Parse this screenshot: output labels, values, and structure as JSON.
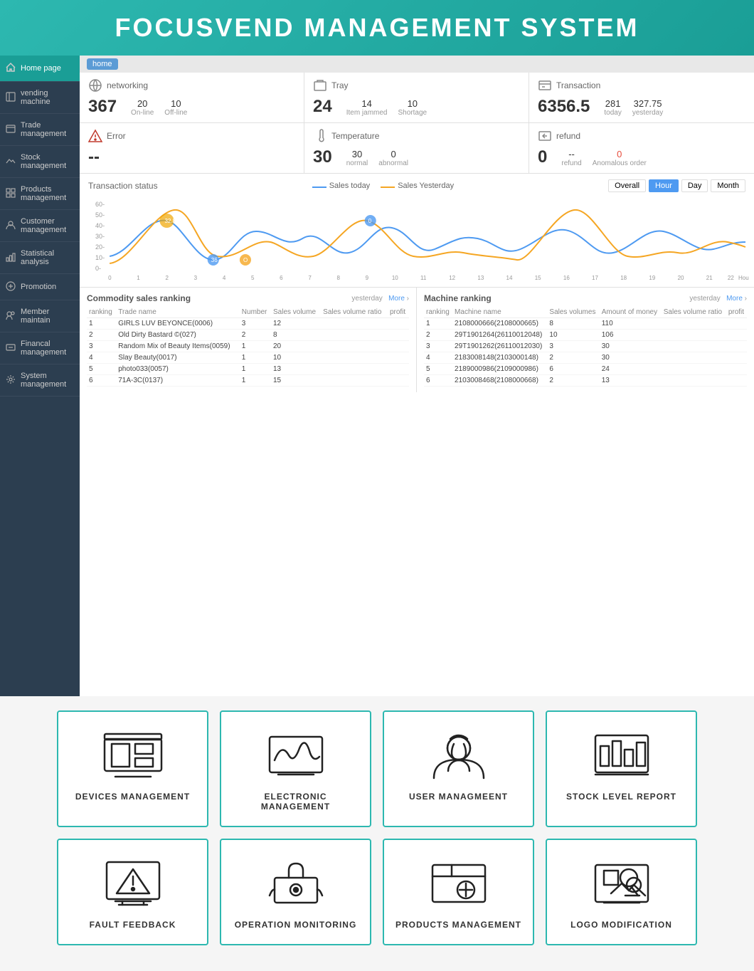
{
  "header": {
    "title": "FOCUSVEND MANAGEMENT SYSTEM"
  },
  "breadcrumb": {
    "home_label": "home"
  },
  "sidebar": {
    "items": [
      {
        "label": "Home page",
        "active": true
      },
      {
        "label": "vending machine",
        "active": false
      },
      {
        "label": "Trade management",
        "active": false
      },
      {
        "label": "Stock management",
        "active": false
      },
      {
        "label": "Products management",
        "active": false
      },
      {
        "label": "Customer management",
        "active": false
      },
      {
        "label": "Statistical analysis",
        "active": false
      },
      {
        "label": "Promotion",
        "active": false
      },
      {
        "label": "Member maintain",
        "active": false
      },
      {
        "label": "Financal management",
        "active": false
      },
      {
        "label": "System management",
        "active": false
      }
    ]
  },
  "stats": {
    "networking": {
      "title": "networking",
      "main": "367",
      "items": [
        {
          "value": "20",
          "label": "On-line"
        },
        {
          "value": "10",
          "label": "Off-line"
        }
      ]
    },
    "tray": {
      "title": "Tray",
      "main": "24",
      "items": [
        {
          "value": "14",
          "label": "Item jammed"
        },
        {
          "value": "10",
          "label": "Shortage"
        }
      ]
    },
    "transaction": {
      "title": "Transaction",
      "main": "6356.5",
      "items": [
        {
          "value": "281",
          "label": "today"
        },
        {
          "value": "327.75",
          "label": "yesterday"
        }
      ]
    },
    "error": {
      "title": "Error",
      "main": "--"
    },
    "temperature": {
      "title": "Temperature",
      "main": "30",
      "items": [
        {
          "value": "30",
          "label": "normal"
        },
        {
          "value": "0",
          "label": "abnormal"
        }
      ]
    },
    "refund": {
      "title": "refund",
      "main": "0",
      "items": [
        {
          "value": "--",
          "label": "refund"
        },
        {
          "value": "0",
          "label": "Anomalous order"
        }
      ]
    }
  },
  "chart": {
    "title": "Transaction status",
    "legend": [
      "Sales today",
      "Sales Yesterday"
    ],
    "buttons": [
      "Overall",
      "Hour",
      "Day",
      "Month"
    ],
    "active_button": "Hour"
  },
  "commodity_table": {
    "title": "Commodity sales ranking",
    "meta_left": "yesterday",
    "meta_right": "More",
    "columns": [
      "ranking",
      "Trade name",
      "Number",
      "Sales volume",
      "Sales volume ratio",
      "profit"
    ],
    "rows": [
      [
        "1",
        "GIRLS LUV BEYONCE(0006)",
        "3",
        "12",
        "",
        ""
      ],
      [
        "2",
        "Old Dirty Bastard ©(027)",
        "2",
        "8",
        "",
        ""
      ],
      [
        "3",
        "Random Mix of Beauty Items(0059)",
        "1",
        "20",
        "",
        ""
      ],
      [
        "4",
        "Slay Beauty(0017)",
        "1",
        "10",
        "",
        ""
      ],
      [
        "5",
        "photo033(0057)",
        "1",
        "13",
        "",
        ""
      ],
      [
        "6",
        "71A-3C(0137)",
        "1",
        "15",
        "",
        ""
      ]
    ]
  },
  "machine_table": {
    "title": "Machine ranking",
    "meta_left": "yesterday",
    "meta_right": "More",
    "columns": [
      "ranking",
      "Machine name",
      "Sales volumes",
      "Amount of money",
      "Sales volume ratio",
      "profit"
    ],
    "rows": [
      [
        "1",
        "2108000666(2108000665)",
        "8",
        "110",
        "",
        ""
      ],
      [
        "2",
        "29T1901264(26110012048)",
        "10",
        "106",
        "",
        ""
      ],
      [
        "3",
        "29T1901262(26110012030)",
        "3",
        "30",
        "",
        ""
      ],
      [
        "4",
        "2183008148(2103000148)",
        "2",
        "30",
        "",
        ""
      ],
      [
        "5",
        "2189000986(2109000986)",
        "6",
        "24",
        "",
        ""
      ],
      [
        "6",
        "2103008468(2108000668)",
        "2",
        "13",
        "",
        ""
      ]
    ]
  },
  "feature_cards": {
    "row1": [
      {
        "label": "DEVICES MANAGEMENT",
        "icon": "devices-icon"
      },
      {
        "label": "ELECTRONIC MANAGEMENT",
        "icon": "electronic-icon"
      },
      {
        "label": "USER MANAGMEENT",
        "icon": "user-icon"
      },
      {
        "label": "STOCK LEVEL REPORT",
        "icon": "stock-icon"
      }
    ],
    "row2": [
      {
        "label": "FAULT FEEDBACK",
        "icon": "fault-icon"
      },
      {
        "label": "OPERATION MONITORING",
        "icon": "operation-icon"
      },
      {
        "label": "PRODUCTS MANAGEMENT",
        "icon": "products-icon"
      },
      {
        "label": "LOGO MODIFICATION",
        "icon": "logo-icon"
      }
    ]
  }
}
